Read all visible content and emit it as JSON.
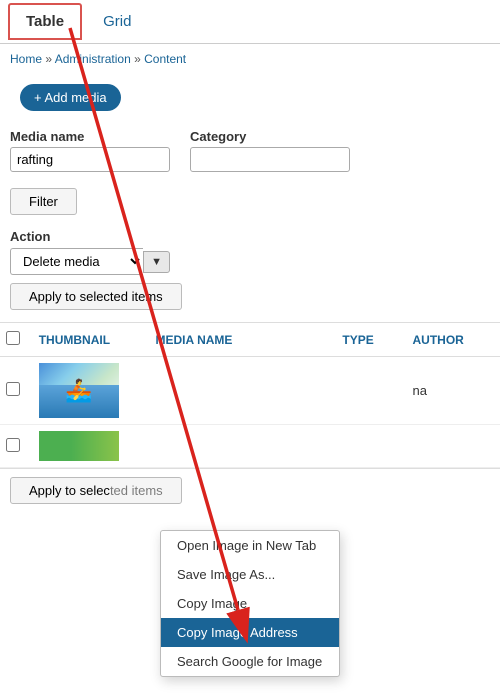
{
  "tabs": [
    {
      "id": "table",
      "label": "Table",
      "active": true
    },
    {
      "id": "grid",
      "label": "Grid",
      "active": false
    }
  ],
  "breadcrumb": {
    "items": [
      "Home",
      "Administration",
      "Content"
    ],
    "separator": "»"
  },
  "addMediaButton": "+ Add media",
  "filterForm": {
    "mediaNameLabel": "Media name",
    "mediaNameValue": "rafting",
    "mediaNamePlaceholder": "",
    "categoryLabel": "Category",
    "categoryValue": "",
    "filterButtonLabel": "Filter"
  },
  "actionArea": {
    "label": "Action",
    "selectOptions": [
      "Delete media"
    ],
    "selectedOption": "Delete media",
    "applyButtonLabel": "Apply to selected items"
  },
  "table": {
    "headers": [
      "",
      "THUMBNAIL",
      "MEDIA NAME",
      "TYPE",
      "AUTHOR"
    ],
    "rows": [
      {
        "hasThumb": true,
        "thumbType": "rafting",
        "mediaName": "",
        "type": "",
        "author": "na"
      },
      {
        "hasThumb": true,
        "thumbType": "green",
        "mediaName": "",
        "type": "",
        "author": ""
      }
    ]
  },
  "contextMenu": {
    "items": [
      {
        "label": "Open Image in New Tab",
        "highlighted": false
      },
      {
        "label": "Save Image As...",
        "highlighted": false
      },
      {
        "label": "Copy Image",
        "highlighted": false
      },
      {
        "label": "Copy Image Address",
        "highlighted": true
      },
      {
        "label": "Search Google for Image",
        "highlighted": false
      }
    ]
  },
  "bottomBar": {
    "applyButtonLabel": "Apply to selec..."
  },
  "arrow": {
    "color": "#d9231d"
  }
}
